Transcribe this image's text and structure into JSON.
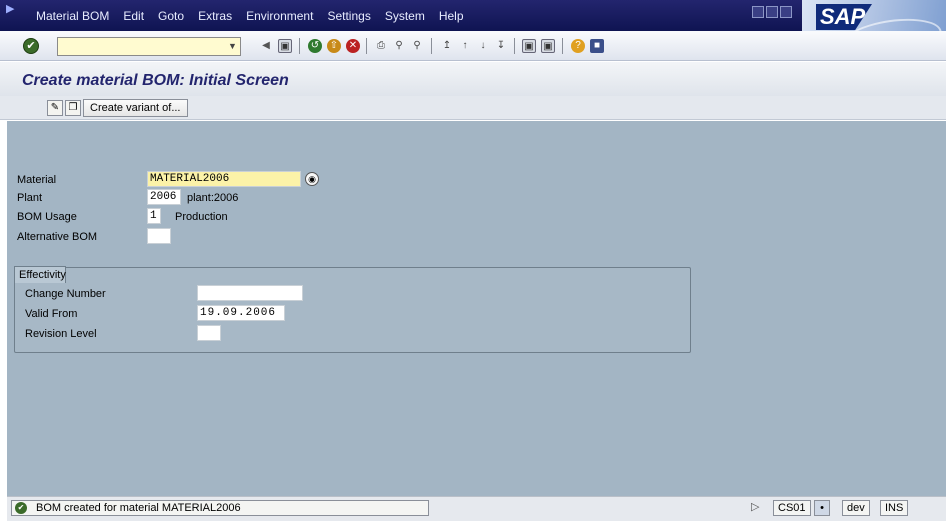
{
  "menu": [
    "Material BOM",
    "Edit",
    "Goto",
    "Extras",
    "Environment",
    "Settings",
    "System",
    "Help"
  ],
  "page_title": "Create material BOM: Initial Screen",
  "app_toolbar": {
    "variant_label": "Create variant of..."
  },
  "fields": {
    "material": {
      "label": "Material",
      "value": "MATERIAL2006"
    },
    "plant": {
      "label": "Plant",
      "value": "2006",
      "text": "plant:2006"
    },
    "bom_usage": {
      "label": "BOM Usage",
      "value": "1",
      "text": "Production"
    },
    "alternative_bom": {
      "label": "Alternative BOM",
      "value": ""
    }
  },
  "effectivity": {
    "title": "Effectivity",
    "change_number": {
      "label": "Change Number",
      "value": ""
    },
    "valid_from": {
      "label": "Valid From",
      "value": "19.09.2006"
    },
    "revision_level": {
      "label": "Revision Level",
      "value": ""
    }
  },
  "status": {
    "message": "BOM created for material MATERIAL2006",
    "transaction": "CS01",
    "system": "dev",
    "mode": "INS"
  },
  "logo": "SAP"
}
